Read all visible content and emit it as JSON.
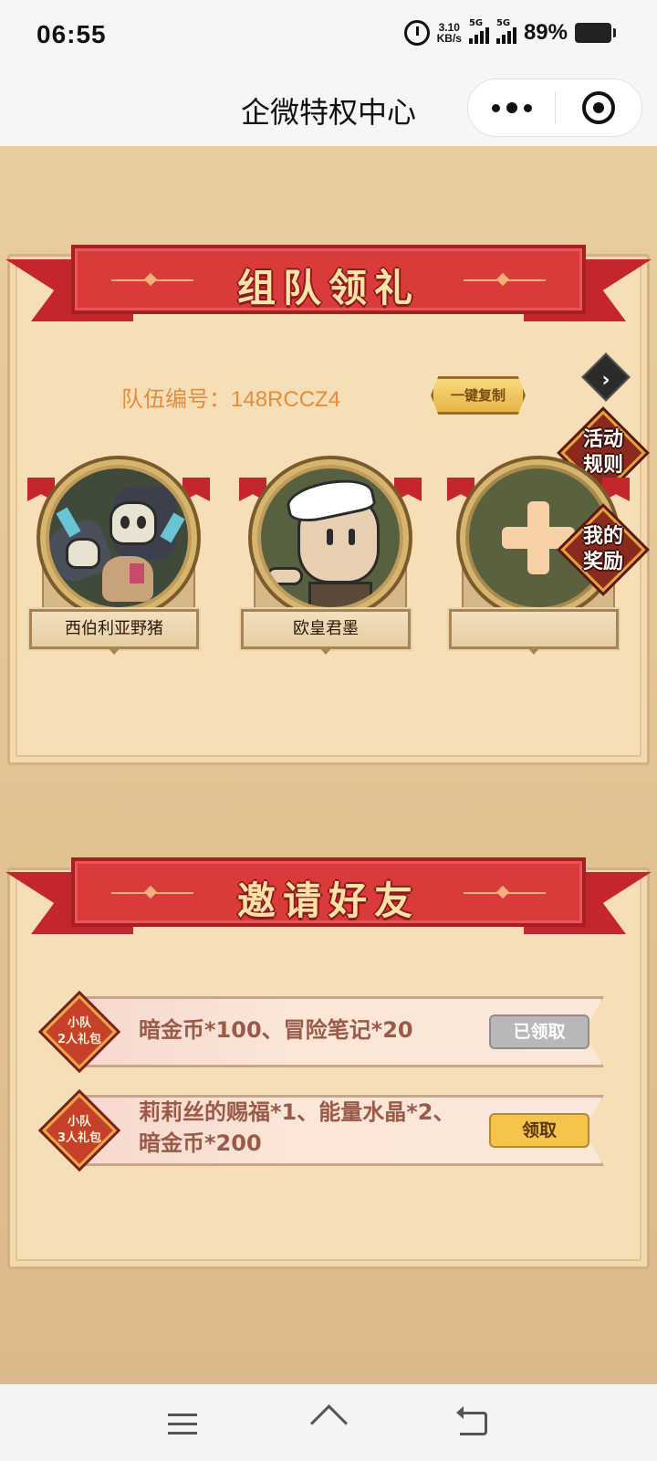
{
  "status_bar": {
    "time": "06:55",
    "net_speed_value": "3.10",
    "net_speed_unit": "KB/s",
    "sim1": "5G",
    "sim2": "5G",
    "battery": "89%"
  },
  "nav": {
    "title": "企微特权中心"
  },
  "team_section": {
    "title": "组队领礼",
    "team_code_label": "队伍编号：",
    "team_code": "148RCCZ4",
    "copy_button": "一键复制",
    "members": [
      {
        "name": "西伯利亚野猪"
      },
      {
        "name": "欧皇君墨"
      },
      {
        "name": ""
      }
    ]
  },
  "side_buttons": {
    "rules": [
      "活动",
      "规则"
    ],
    "rewards": [
      "我的",
      "奖励"
    ]
  },
  "invite_section": {
    "title": "邀请好友",
    "gifts": [
      {
        "badge": [
          "小队",
          "2人礼包"
        ],
        "desc_lines": [
          "暗金币*100、冒险笔记*20"
        ],
        "button": "已领取",
        "state": "claimed"
      },
      {
        "badge": [
          "小队",
          "3人礼包"
        ],
        "desc_lines": [
          "莉莉丝的赐福*1、能量水晶*2、",
          "暗金币*200"
        ],
        "button": "领取",
        "state": "available"
      }
    ]
  },
  "colors": {
    "ribbon_red": "#d93a3a",
    "team_code_orange": "#e38d3c",
    "claim_yellow": "#f5c44a",
    "claimed_gray": "#b8b8b8"
  },
  "icons": [
    "alarm-icon",
    "signal-icon",
    "battery-icon",
    "more-icon",
    "target-icon",
    "chevron-right-icon",
    "plus-icon",
    "menu-icon",
    "home-icon",
    "back-icon"
  ]
}
